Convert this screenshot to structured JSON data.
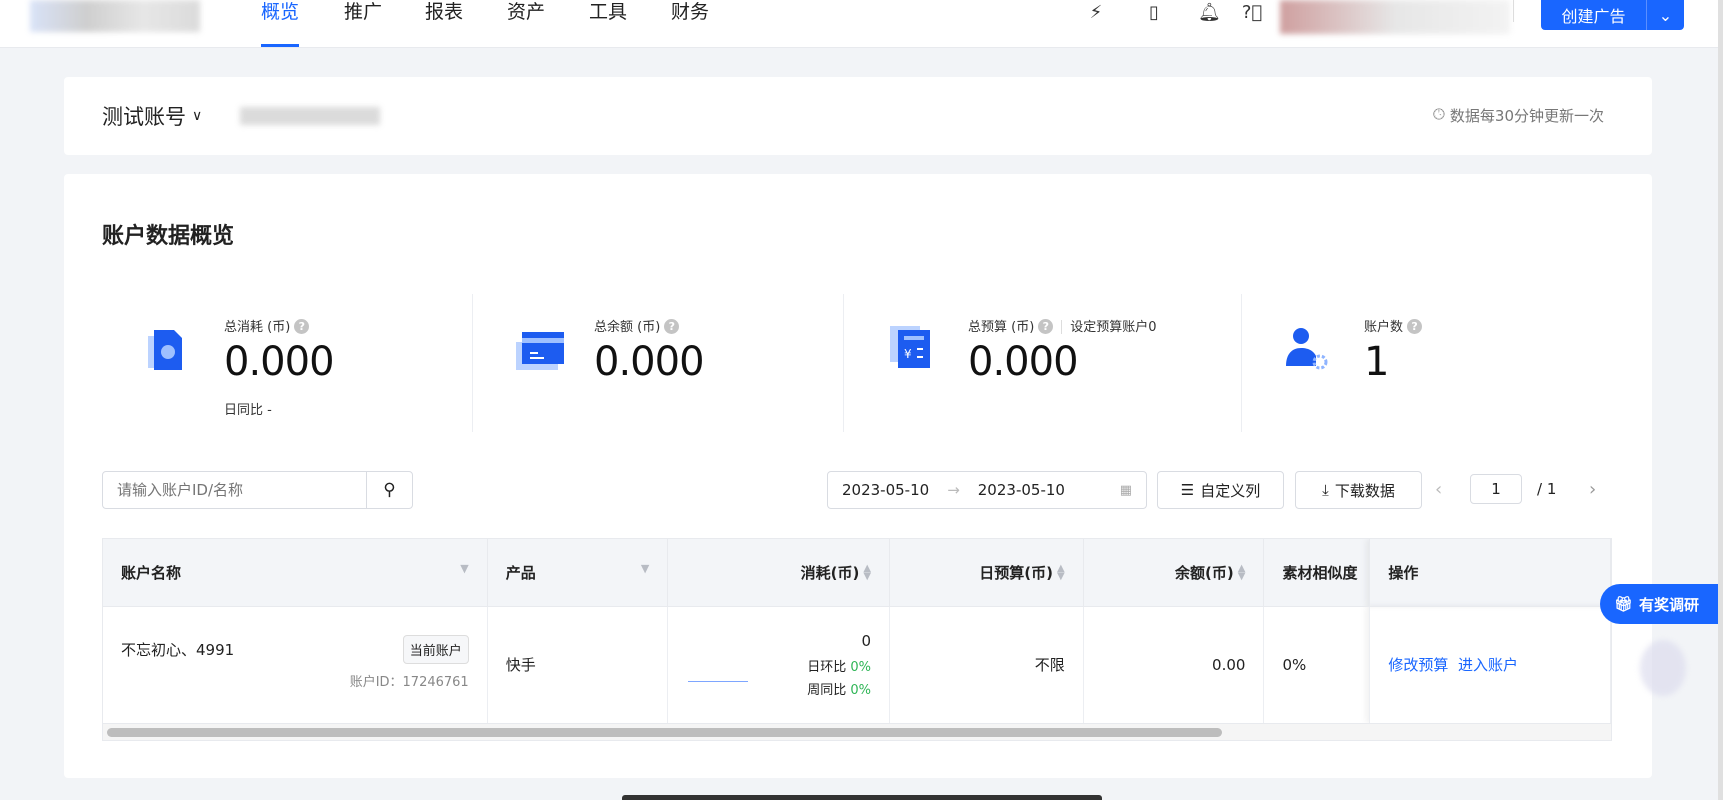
{
  "nav": {
    "items": [
      "概览",
      "推广",
      "报表",
      "资产",
      "工具",
      "财务"
    ],
    "active": 0,
    "create_label": "创建广告"
  },
  "account": {
    "name": "测试账号",
    "update_note": "数据每30分钟更新一次"
  },
  "overview": {
    "title": "账户数据概览",
    "stats": [
      {
        "label": "总消耗 (币)",
        "value": "0.000",
        "sub": "日同比 -"
      },
      {
        "label": "总余额 (币)",
        "value": "0.000"
      },
      {
        "label": "总预算 (币)",
        "value": "0.000",
        "extra": "设定预算账户0"
      },
      {
        "label": "账户数",
        "value": "1"
      }
    ]
  },
  "toolbar": {
    "search_placeholder": "请输入账户ID/名称",
    "date_start": "2023-05-10",
    "date_end": "2023-05-10",
    "custom_columns": "自定义列",
    "download": "下载数据",
    "page": "1",
    "total_pages": "/ 1"
  },
  "table": {
    "headers": [
      "账户名称",
      "产品",
      "消耗(币)",
      "日预算(币)",
      "余额(币)",
      "素材相似度",
      "操作"
    ],
    "rows": [
      {
        "name": "不忘初心、4991",
        "badge": "当前账户",
        "account_id": "账户ID：17246761",
        "product": "快手",
        "cost": "0",
        "dod_label": "日环比",
        "dod": "0%",
        "wow_label": "周同比",
        "wow": "0%",
        "daily_budget": "不限",
        "balance": "0.00",
        "similarity": "0%",
        "actions": [
          "修改预算",
          "进入账户"
        ]
      }
    ]
  },
  "survey": {
    "label": "有奖调研"
  },
  "colors": {
    "primary": "#1966ff",
    "green": "#2fb556"
  }
}
